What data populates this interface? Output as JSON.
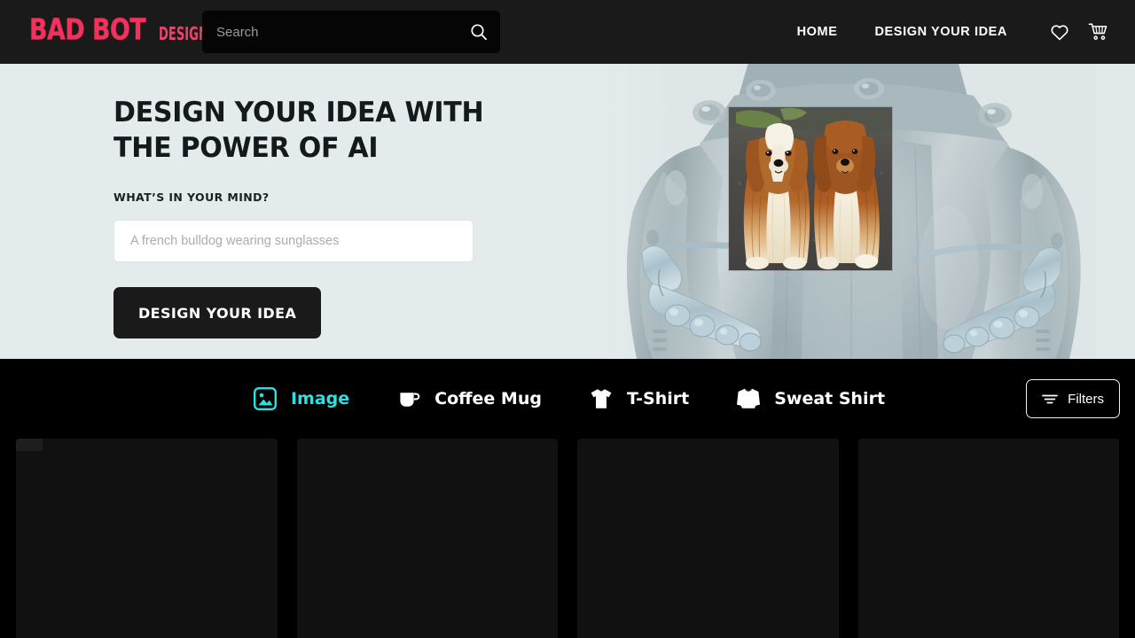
{
  "header": {
    "logo_main": "BAD BOT",
    "logo_sub": "DESIGN",
    "search": {
      "placeholder": "Search",
      "value": "",
      "icon": "search-icon"
    },
    "nav": [
      {
        "label": "HOME",
        "name": "nav-home"
      },
      {
        "label": "DESIGN YOUR IDEA",
        "name": "nav-design-your-idea"
      }
    ],
    "icons": [
      {
        "name": "wishlist-heart-icon",
        "glyph": "heart"
      },
      {
        "name": "cart-icon",
        "glyph": "cart"
      }
    ]
  },
  "hero": {
    "title": "DESIGN YOUR IDEA WITH THE POWER OF AI",
    "subtitle": "WHAT’S IN YOUR MIND?",
    "prompt_input": {
      "placeholder": "A french bulldog wearing sunglasses",
      "value": ""
    },
    "cta_label": "DESIGN YOUR IDEA",
    "artwork": {
      "description": "robot holding generated image",
      "generated_image": "two long-haired brown and white dogs standing on pavement",
      "background_color": "#e4ebed"
    }
  },
  "tabbar": {
    "tabs": [
      {
        "label": "Image",
        "icon": "image-icon",
        "active": true
      },
      {
        "label": "Coffee Mug",
        "icon": "coffee-mug-icon",
        "active": false
      },
      {
        "label": "T-Shirt",
        "icon": "tshirt-icon",
        "active": false
      },
      {
        "label": "Sweat Shirt",
        "icon": "sweatshirt-icon",
        "active": false
      }
    ],
    "active_color": "#2ae0e0",
    "filters_label": "Filters",
    "filters_icon": "filter-icon"
  },
  "grid": {
    "cards": [
      {
        "name": "result-card-1",
        "state": "loading"
      },
      {
        "name": "result-card-2",
        "state": "loading"
      },
      {
        "name": "result-card-3",
        "state": "loading"
      },
      {
        "name": "result-card-4",
        "state": "loading"
      }
    ]
  }
}
